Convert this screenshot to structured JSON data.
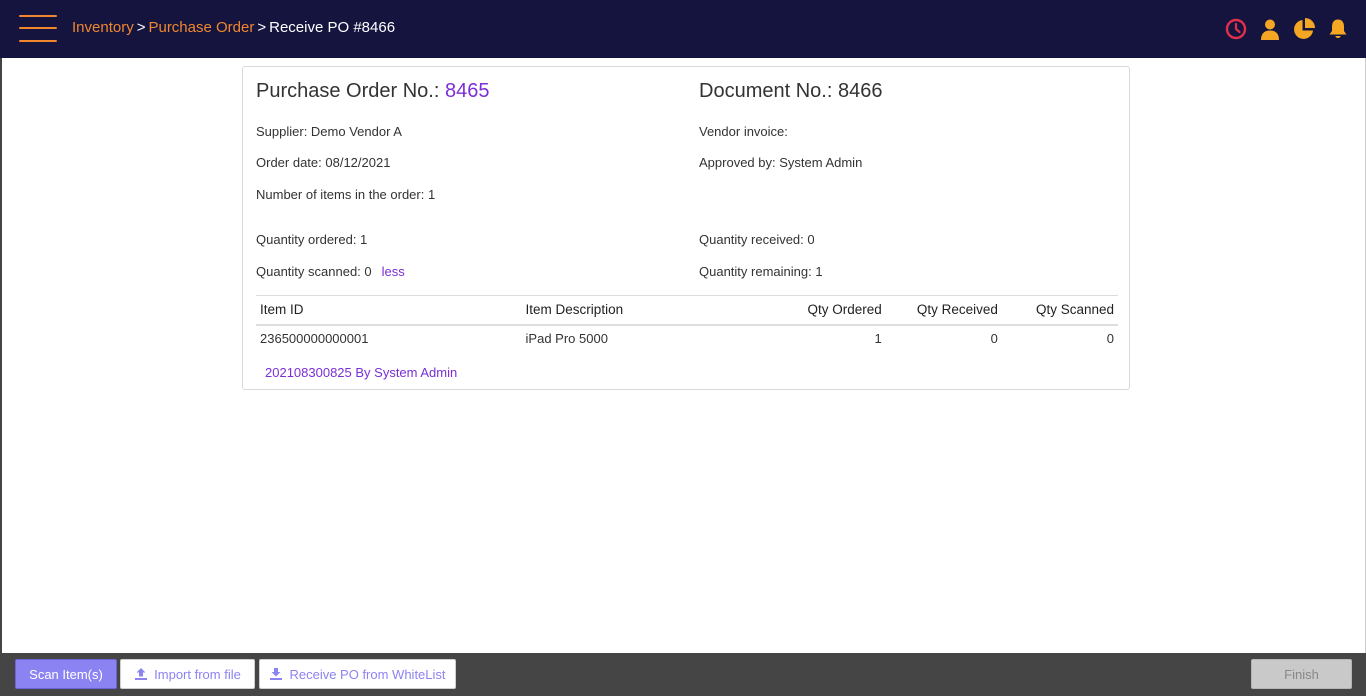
{
  "header": {
    "breadcrumb": {
      "inventory": "Inventory",
      "sep1": ">",
      "purchase_order": "Purchase Order",
      "sep2": ">",
      "current": "Receive PO #8466"
    },
    "icons": [
      "clock-icon",
      "user-icon",
      "pie-chart-icon",
      "bell-icon"
    ]
  },
  "po": {
    "po_label": "Purchase Order No.:",
    "po_number": "8465",
    "doc_label": "Document No.:",
    "doc_number": "8466",
    "supplier": "Supplier: Demo Vendor A",
    "vendor_invoice": "Vendor invoice:",
    "order_date": "Order date: 08/12/2021",
    "approved_by": "Approved by: System Admin",
    "num_items": "Number of items in the order: 1",
    "qty_ordered": "Quantity ordered: 1",
    "qty_received": "Quantity received: 0",
    "qty_scanned": "Quantity scanned: 0",
    "less_link": "less",
    "qty_remaining": "Quantity remaining: 1"
  },
  "table": {
    "headers": {
      "item_id": "Item ID",
      "description": "Item Description",
      "qty_ordered": "Qty Ordered",
      "qty_received": "Qty Received",
      "qty_scanned": "Qty Scanned"
    },
    "rows": [
      {
        "item_id": "236500000000001",
        "description": "iPad Pro 5000",
        "qty_ordered": "1",
        "qty_received": "0",
        "qty_scanned": "0"
      }
    ]
  },
  "log_entry": "202108300825 By System Admin",
  "footer": {
    "scan_label": "Scan Item(s)",
    "import_label": "Import from file",
    "whitelist_label": "Receive PO from WhiteList",
    "finish_label": "Finish"
  },
  "colors": {
    "header_bg": "#14143f",
    "accent_orange": "#f0872f",
    "accent_purple": "#7b2fd6",
    "button_purple": "#8c83f2",
    "clock_red": "#e0304a",
    "icon_yellow": "#f5a623",
    "footer_bg": "#454545"
  }
}
